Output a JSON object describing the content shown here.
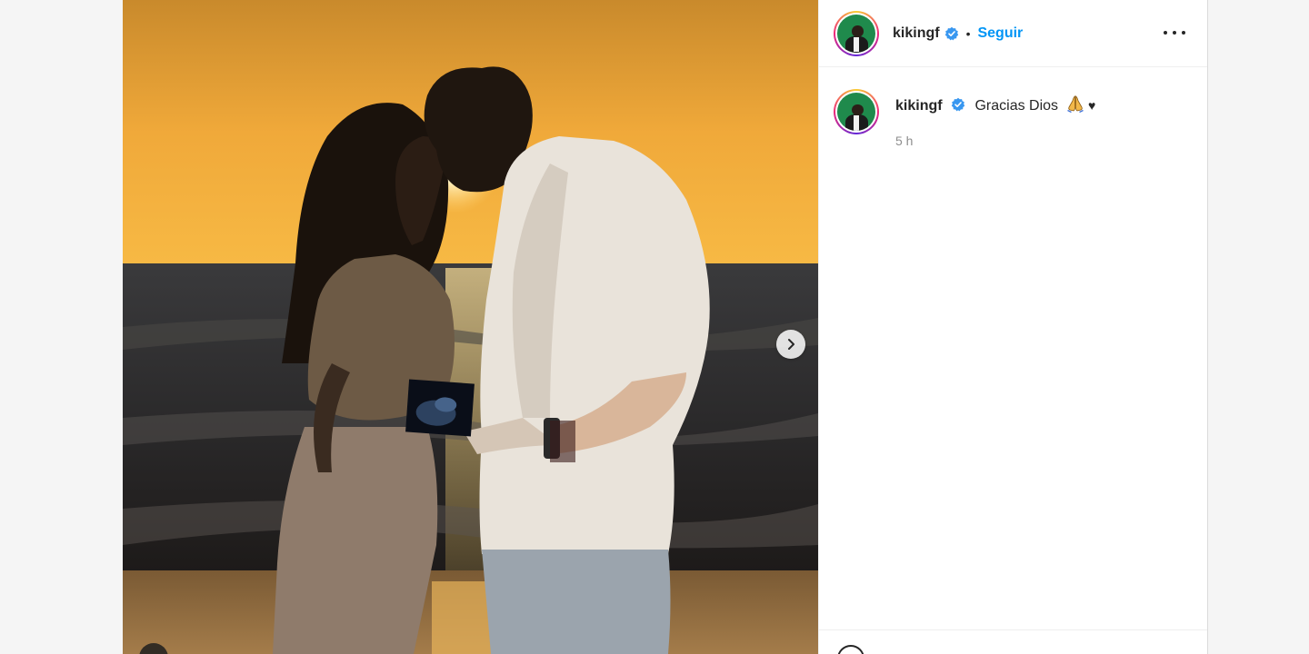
{
  "post": {
    "author": "kikingf",
    "verified": true,
    "separator": "•",
    "follow_label": "Seguir",
    "caption_text": "Gracias Dios",
    "caption_heart": "♥",
    "timestamp": "5 h"
  },
  "icons": {
    "more": "more-options-icon",
    "next": "chevron-right-icon",
    "verified": "verified-badge-icon",
    "emoji": "folded-hands-emoji"
  },
  "colors": {
    "accent": "#0095f6",
    "text": "#262626",
    "muted": "#8e8e8e",
    "verified": "#3897f0"
  }
}
